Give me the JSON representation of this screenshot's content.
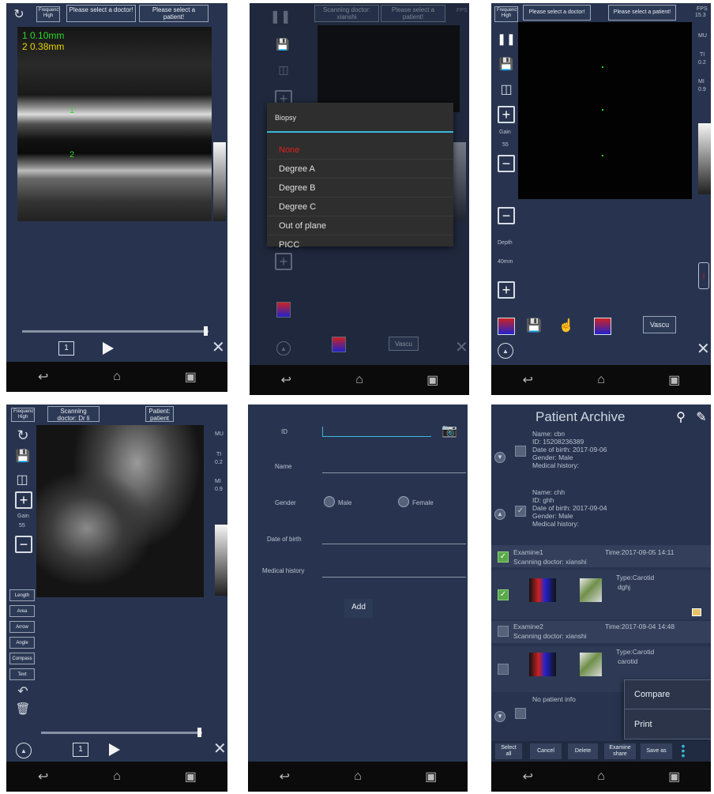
{
  "screens": {
    "s1": {
      "frequency_label": "Frequency\nHigh",
      "doctor_button": "Please select a doctor!",
      "patient_button": "Please select a patient!",
      "measure1": "1 0.10mm",
      "measure2": "2 0.38mm",
      "marker1": "1",
      "marker2": "2",
      "frame_number": "1"
    },
    "s2": {
      "doctor_button": "Scanning doctor: xianshi",
      "patient_button": "Please select a patient!",
      "dropdown_title": "Biopsy",
      "dropdown_items": [
        "None",
        "Degree A",
        "Degree B",
        "Degree C",
        "Out of plane",
        "PICC"
      ],
      "selected_index": 0,
      "vascular_button": "Vascu",
      "side_label": "FPS"
    },
    "s3": {
      "frequency_label": "Frequency\nHigh",
      "doctor_button": "Please select a doctor!",
      "patient_button": "Please select a patient!",
      "fps_label": "FPS",
      "fps_value": "15.3",
      "gain_label": "Gain",
      "gain_value": "55",
      "depth_label": "Depth",
      "depth_value": "40mm",
      "vascular_button": "Vascu",
      "side_labels": [
        "MU",
        "TI",
        "0.2",
        "MI",
        "0.9"
      ]
    },
    "s4": {
      "frequency_label": "Frequency\nHigh",
      "doctor_button": "Scanning doctor: Dr li",
      "patient_button": "Patient: patient",
      "gain_label": "Gain",
      "gain_value": "55",
      "measure_tools": [
        "Length",
        "Area",
        "Arrow",
        "Angle",
        "Compass",
        "Text"
      ],
      "frame_number": "1",
      "side_labels": [
        "MU",
        "TI",
        "0.2",
        "MI",
        "0.9"
      ]
    },
    "s5": {
      "id_label": "ID",
      "name_label": "Name",
      "gender_label": "Gender",
      "male_label": "Male",
      "female_label": "Female",
      "dob_label": "Date of birth",
      "history_label": "Medical history",
      "add_button": "Add"
    },
    "s6": {
      "title": "Patient Archive",
      "patients": [
        {
          "name": "Name: cbn",
          "id": "ID: 15208236389",
          "dob": "Date of birth: 2017-09-06",
          "gender": "Gender: Male",
          "history": "Medical history:"
        },
        {
          "name": "Name: chh",
          "id": "ID: ghh",
          "dob": "Date of birth: 2017-09-04",
          "gender": "Gender: Male",
          "history": "Medical history:"
        }
      ],
      "exams": [
        {
          "label": "Examine1",
          "time": "Time:2017-09-05 14:11",
          "doctor": "Scanning doctor: xianshi",
          "type": "Type:Carotid",
          "note": "dghj"
        },
        {
          "label": "Examine2",
          "time": "Time:2017-09-04 14:48",
          "doctor": "Scanning doctor: xianshi",
          "type": "Type:Carotid",
          "note": "carotid"
        }
      ],
      "no_patient_info": "No patient info",
      "popup_items": [
        "Compare",
        "Print"
      ],
      "actions": [
        "Select all",
        "Cancel",
        "Delete",
        "Examine share",
        "Save as"
      ]
    }
  },
  "colors": {
    "panel_bg": "#28344f",
    "accent_cyan": "#39b8d8",
    "selected_red": "#e02020",
    "measure_green": "#2bd92b",
    "measure_yellow": "#e6d400"
  }
}
